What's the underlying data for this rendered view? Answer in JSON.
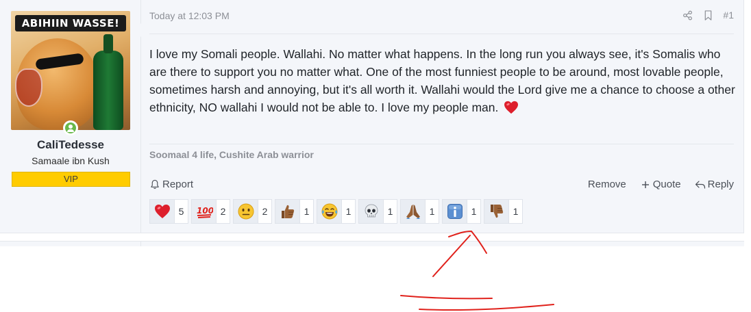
{
  "user": {
    "avatar_caption": "ABIHIIN WASSE!",
    "username": "CaliTedesse",
    "title": "Samaale ibn Kush",
    "badge": "VIP",
    "online": true
  },
  "post": {
    "date": "Today at 12:03 PM",
    "number": "#1",
    "body_line1": "I love my Somali people. Wallahi. No matter what happens. In the long run you always see, it's Somalis who are there to support you no matter what. One of the most funniest people to be around, most lovable people,",
    "body_line2": "sometimes harsh and annoying, but it's all worth it. Wallahi would the Lord give me a chance to choose a other ethnicity, NO wallahi I would not be able to. I love my people man.",
    "signature": "Soomaal 4 life, Cushite Arab warrior"
  },
  "actions": {
    "report": "Report",
    "remove": "Remove",
    "quote": "Quote",
    "reply": "Reply"
  },
  "reactions": [
    {
      "icon": "heart-emoji",
      "count": "5"
    },
    {
      "icon": "hundred-points-emoji",
      "count": "2"
    },
    {
      "icon": "neutral-face-emoji",
      "count": "2"
    },
    {
      "icon": "thumbs-up-emoji",
      "count": "1"
    },
    {
      "icon": "tears-of-joy-emoji",
      "count": "1"
    },
    {
      "icon": "skull-emoji",
      "count": "1"
    },
    {
      "icon": "folded-hands-emoji",
      "count": "1"
    },
    {
      "icon": "information-emoji",
      "count": "1"
    },
    {
      "icon": "thumbs-down-emoji",
      "count": "1"
    }
  ],
  "colors": {
    "background": "#f4f6fa",
    "badge": "#ffcc00",
    "annotation": "#e0211b",
    "online": "#68b84a"
  }
}
